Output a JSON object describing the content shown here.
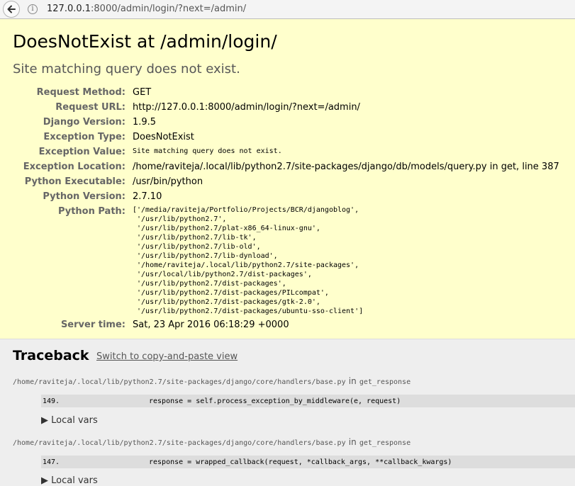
{
  "browser": {
    "url_host": "127.0.0.1",
    "url_rest": ":8000/admin/login/?next=/admin/"
  },
  "summary": {
    "title": "DoesNotExist at /admin/login/",
    "subtitle": "Site matching query does not exist.",
    "meta": [
      {
        "label": "Request Method:",
        "value": "GET"
      },
      {
        "label": "Request URL:",
        "value": "http://127.0.0.1:8000/admin/login/?next=/admin/"
      },
      {
        "label": "Django Version:",
        "value": "1.9.5"
      },
      {
        "label": "Exception Type:",
        "value": "DoesNotExist"
      },
      {
        "label": "Exception Value:",
        "value": "Site matching query does not exist."
      },
      {
        "label": "Exception Location:",
        "value": "/home/raviteja/.local/lib/python2.7/site-packages/django/db/models/query.py in get, line 387"
      },
      {
        "label": "Python Executable:",
        "value": "/usr/bin/python"
      },
      {
        "label": "Python Version:",
        "value": "2.7.10"
      },
      {
        "label": "Python Path:",
        "value": "['/media/raviteja/Portfolio/Projects/BCR/djangoblog',\n '/usr/lib/python2.7',\n '/usr/lib/python2.7/plat-x86_64-linux-gnu',\n '/usr/lib/python2.7/lib-tk',\n '/usr/lib/python2.7/lib-old',\n '/usr/lib/python2.7/lib-dynload',\n '/home/raviteja/.local/lib/python2.7/site-packages',\n '/usr/local/lib/python2.7/dist-packages',\n '/usr/lib/python2.7/dist-packages',\n '/usr/lib/python2.7/dist-packages/PILcompat',\n '/usr/lib/python2.7/dist-packages/gtk-2.0',\n '/usr/lib/python2.7/dist-packages/ubuntu-sso-client']"
      },
      {
        "label": "Server time:",
        "value": "Sat, 23 Apr 2016 06:18:29 +0000"
      }
    ]
  },
  "traceback": {
    "heading": "Traceback",
    "switch_link": "Switch to copy-and-paste view",
    "in_word": "in",
    "local_vars_label": "▶ Local vars",
    "frames": [
      {
        "file": "/home/raviteja/.local/lib/python2.7/site-packages/django/core/handlers/base.py",
        "function": "get_response",
        "lineno": "149.",
        "code": "response = self.process_exception_by_middleware(e, request)"
      },
      {
        "file": "/home/raviteja/.local/lib/python2.7/site-packages/django/core/handlers/base.py",
        "function": "get_response",
        "lineno": "147.",
        "code": "response = wrapped_callback(request, *callback_args, **callback_kwargs)"
      }
    ]
  }
}
